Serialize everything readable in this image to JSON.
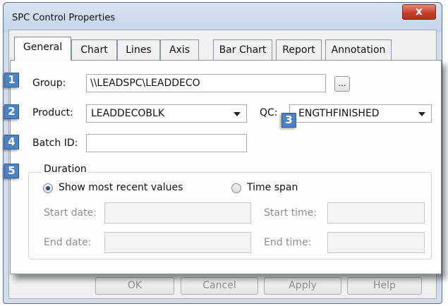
{
  "window": {
    "title": "SPC Control Properties",
    "close_glyph": "x"
  },
  "tabs": [
    "General",
    "Chart",
    "Lines",
    "Axis",
    "Bar Chart",
    "Report",
    "Annotation"
  ],
  "active_tab": "General",
  "callouts": [
    "1",
    "2",
    "3",
    "4",
    "5"
  ],
  "group": {
    "label": "Group:",
    "value": "\\\\LEADSPC\\LEADDECO",
    "browse_label": "..."
  },
  "product": {
    "label": "Product:",
    "value": "LEADDECOBLK"
  },
  "qc": {
    "label": "QC:",
    "value": "ENGTHFINISHED"
  },
  "batch": {
    "label": "Batch ID:",
    "value": ""
  },
  "duration": {
    "legend": "Duration",
    "option_recent": "Show most recent values",
    "option_span": "Time span",
    "selected": "Show most recent values",
    "start_date_label": "Start date:",
    "end_date_label": "End date:",
    "start_time_label": "Start time:",
    "end_time_label": "End time:"
  },
  "buttons": {
    "ok": "OK",
    "cancel": "Cancel",
    "apply": "Apply",
    "help": "Help"
  },
  "colors": {
    "callout": "#4f82c0",
    "close": "#c7402b",
    "disabled_text": "#8d8d8d"
  }
}
